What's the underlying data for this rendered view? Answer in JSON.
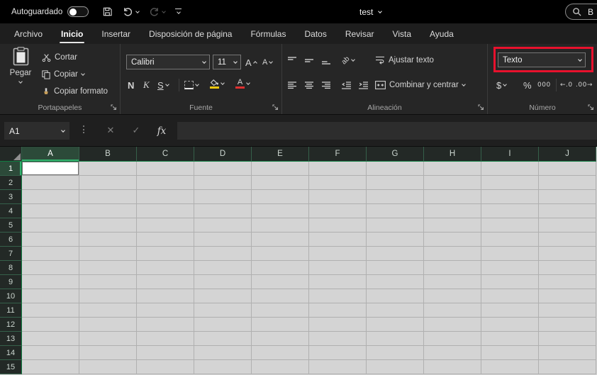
{
  "titlebar": {
    "autosave_label": "Autoguardado",
    "autosave_on": false,
    "document_title": "test",
    "search_text": "B"
  },
  "tabs": [
    {
      "label": "Archivo",
      "active": false
    },
    {
      "label": "Inicio",
      "active": true
    },
    {
      "label": "Insertar",
      "active": false
    },
    {
      "label": "Disposición de página",
      "active": false
    },
    {
      "label": "Fórmulas",
      "active": false
    },
    {
      "label": "Datos",
      "active": false
    },
    {
      "label": "Revisar",
      "active": false
    },
    {
      "label": "Vista",
      "active": false
    },
    {
      "label": "Ayuda",
      "active": false
    }
  ],
  "ribbon": {
    "clipboard": {
      "label": "Portapapeles",
      "paste_label": "Pegar",
      "cut_label": "Cortar",
      "copy_label": "Copiar",
      "format_painter_label": "Copiar formato"
    },
    "font": {
      "label": "Fuente",
      "font_name": "Calibri",
      "font_size": "11",
      "grow_font_label": "A",
      "shrink_font_label": "A",
      "bold_label": "N",
      "italic_label": "K",
      "underline_label": "S"
    },
    "alignment": {
      "label": "Alineación",
      "orientation_glyph": "ab",
      "wrap_text_label": "Ajustar texto",
      "merge_center_label": "Combinar y centrar"
    },
    "number": {
      "label": "Número",
      "format_value": "Texto",
      "currency_label": "$",
      "percent_label": "%",
      "thousands_label": "000",
      "increase_decimal_glyph": "←.0",
      "decrease_decimal_glyph": ".00→"
    }
  },
  "formula_bar": {
    "name_box_value": "A1",
    "cancel_glyph": "✕",
    "confirm_glyph": "✓",
    "fx_label": "fx",
    "formula_value": ""
  },
  "grid": {
    "columns": [
      "A",
      "B",
      "C",
      "D",
      "E",
      "F",
      "G",
      "H",
      "I",
      "J"
    ],
    "rows": [
      "1",
      "2",
      "3",
      "4",
      "5",
      "6",
      "7",
      "8",
      "9",
      "10",
      "11",
      "12",
      "13",
      "14",
      "15"
    ],
    "selected_cell": "A1"
  },
  "annotation": {
    "type": "highlight-box",
    "target": "number-format-dropdown"
  },
  "colors": {
    "titlebar_bg": "#000000",
    "ribbon_bg": "#262626",
    "excel_green": "#107c41",
    "header_bg": "#232926",
    "header_line": "#35604a",
    "grid_cell": "#d4d4d4",
    "gridline": "#b0b0b0",
    "highlight_red": "#e8112d",
    "fill_yellow": "#f2c80f",
    "font_red": "#e03131"
  }
}
